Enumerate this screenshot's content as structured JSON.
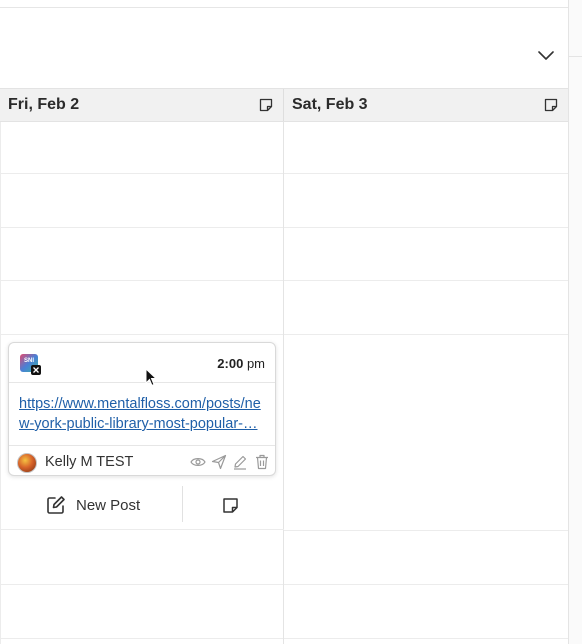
{
  "calendar": {
    "days": [
      {
        "label": "Fri, Feb 2"
      },
      {
        "label": "Sat, Feb 3"
      }
    ]
  },
  "post": {
    "time_hour": "2:00",
    "time_ampm": "pm",
    "network_icon": "sni-x-icon",
    "link_text": "https://www.mentalfloss.com/posts/new-york-public-library-most-popular-…",
    "author": "Kelly M TEST",
    "actions": [
      "eye-icon",
      "send-icon",
      "pencil-icon",
      "trash-icon"
    ]
  },
  "toolbar": {
    "new_post_label": "New Post"
  },
  "colors": {
    "link": "#1f5fa8",
    "header_bg": "#f1f1f1",
    "border": "#e4e4e4"
  }
}
